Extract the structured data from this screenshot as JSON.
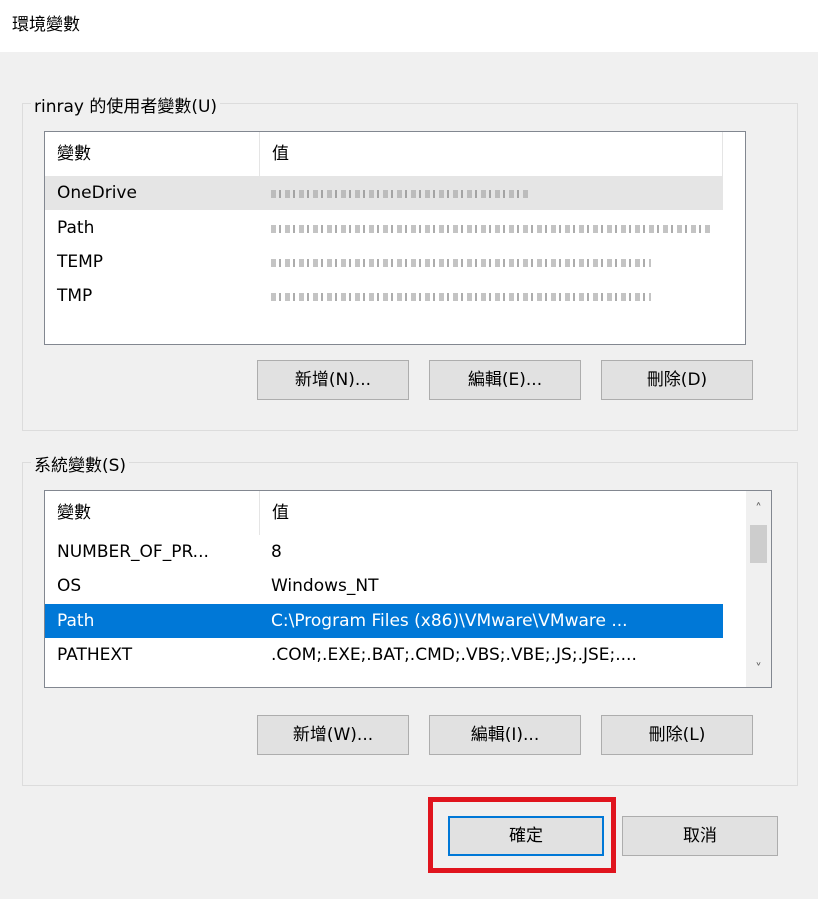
{
  "window": {
    "title": "環境變數"
  },
  "user_vars": {
    "legend": "rinray 的使用者變數(U)",
    "headers": {
      "name": "變數",
      "value": "值"
    },
    "rows": [
      {
        "name": "OneDrive"
      },
      {
        "name": "Path"
      },
      {
        "name": "TEMP"
      },
      {
        "name": "TMP"
      }
    ],
    "buttons": {
      "new": "新增(N)...",
      "edit": "編輯(E)...",
      "delete": "刪除(D)"
    }
  },
  "system_vars": {
    "legend": "系統變數(S)",
    "headers": {
      "name": "變數",
      "value": "值"
    },
    "rows": [
      {
        "name": "NUMBER_OF_PR...",
        "value": "8"
      },
      {
        "name": "OS",
        "value": "Windows_NT"
      },
      {
        "name": "Path",
        "value": "C:\\Program Files (x86)\\VMware\\VMware ..."
      },
      {
        "name": "PATHEXT",
        "value": ".COM;.EXE;.BAT;.CMD;.VBS;.VBE;.JS;.JSE;...."
      }
    ],
    "buttons": {
      "new": "新增(W)...",
      "edit": "編輯(I)...",
      "delete": "刪除(L)"
    }
  },
  "dialog_buttons": {
    "ok": "確定",
    "cancel": "取消"
  },
  "icons": {
    "scroll_up": "chevron-up-icon",
    "scroll_down": "chevron-down-icon"
  },
  "colors": {
    "selection": "#0078d7",
    "highlight_box": "#e0141e"
  }
}
